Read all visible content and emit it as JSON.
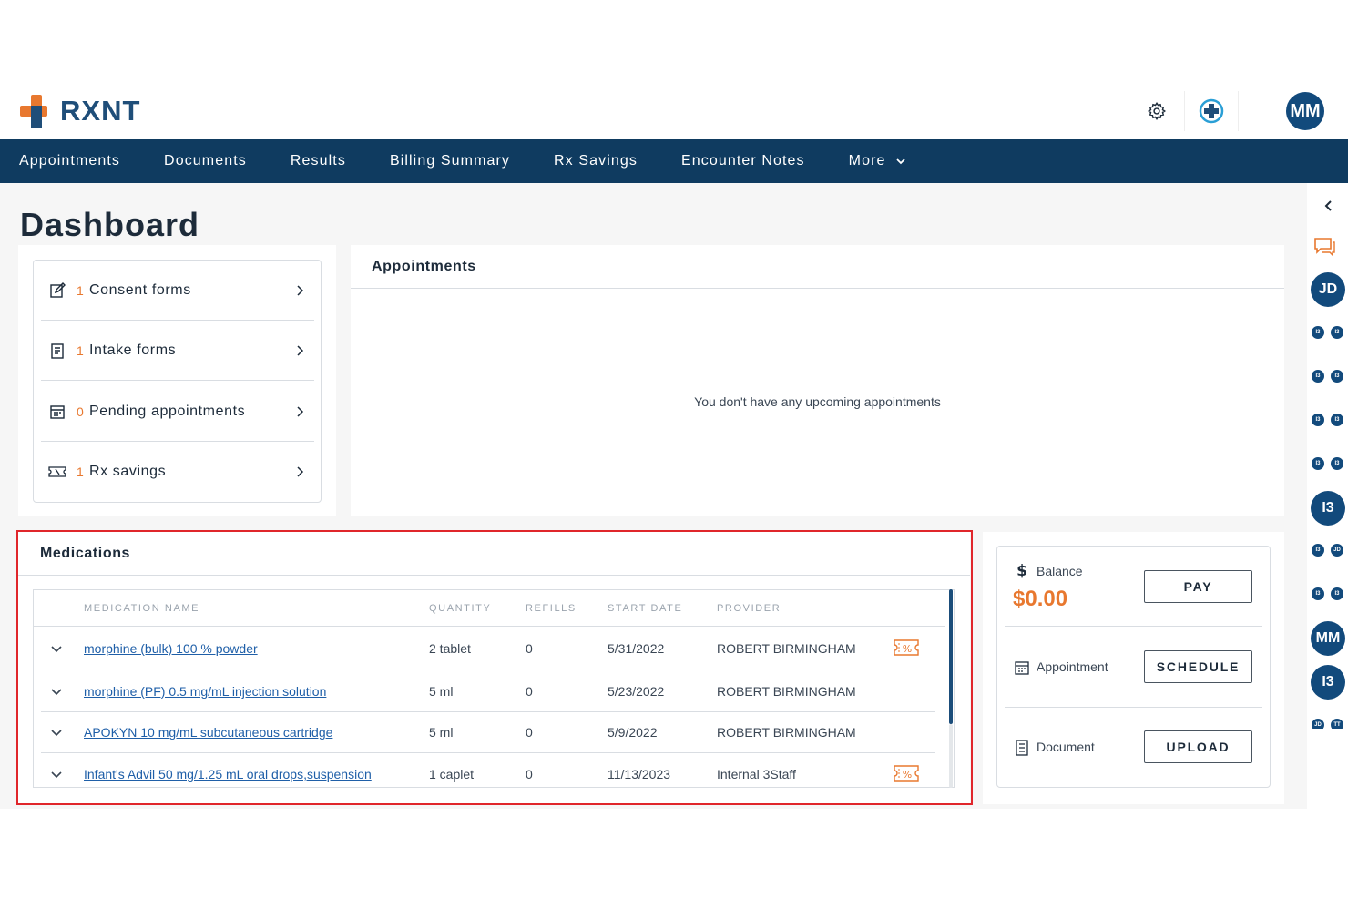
{
  "header": {
    "brand": "RXNT",
    "user_initials": "MM",
    "colors": {
      "brand_blue": "#1f4e79",
      "brand_orange": "#e8782f",
      "nav_bg": "#0f3b60"
    }
  },
  "nav": {
    "items": [
      "Appointments",
      "Documents",
      "Results",
      "Billing Summary",
      "Rx Savings",
      "Encounter Notes"
    ],
    "more_label": "More"
  },
  "page_title": "Dashboard",
  "quick_links": [
    {
      "count": "1",
      "label": "Consent forms",
      "icon": "edit-form-icon"
    },
    {
      "count": "1",
      "label": "Intake forms",
      "icon": "clipboard-icon"
    },
    {
      "count": "0",
      "label": "Pending appointments",
      "icon": "calendar-icon"
    },
    {
      "count": "1",
      "label": "Rx savings",
      "icon": "coupon-icon"
    }
  ],
  "appointments": {
    "title": "Appointments",
    "empty_message": "You don't have any upcoming appointments"
  },
  "medications": {
    "title": "Medications",
    "columns": [
      "MEDICATION NAME",
      "QUANTITY",
      "REFILLS",
      "START DATE",
      "PROVIDER"
    ],
    "rows": [
      {
        "name": "morphine (bulk) 100 % powder",
        "quantity": "2 tablet",
        "refills": "0",
        "start_date": "5/31/2022",
        "provider": "ROBERT BIRMINGHAM",
        "rx_savings": true
      },
      {
        "name": "morphine (PF) 0.5 mg/mL injection solution",
        "quantity": "5 ml",
        "refills": "0",
        "start_date": "5/23/2022",
        "provider": "ROBERT BIRMINGHAM",
        "rx_savings": false
      },
      {
        "name": "APOKYN 10 mg/mL subcutaneous cartridge",
        "quantity": "5 ml",
        "refills": "0",
        "start_date": "5/9/2022",
        "provider": "ROBERT BIRMINGHAM",
        "rx_savings": false
      },
      {
        "name": "Infant's Advil 50 mg/1.25 mL oral drops,suspension",
        "quantity": "1 caplet",
        "refills": "0",
        "start_date": "11/13/2023",
        "provider": "Internal 3Staff",
        "rx_savings": true
      }
    ]
  },
  "billing": {
    "balance_label": "Balance",
    "balance_amount": "$0.00",
    "pay_label": "PAY",
    "appointment_label": "Appointment",
    "schedule_label": "SCHEDULE",
    "document_label": "Document",
    "upload_label": "UPLOAD"
  },
  "rail": {
    "avatars": [
      "JD",
      "I3",
      "MM",
      "I3"
    ],
    "small_pairs": [
      [
        "I3",
        "I3"
      ],
      [
        "I3",
        "I3"
      ],
      [
        "I3",
        "I3"
      ],
      [
        "I3",
        "I3"
      ],
      [
        "I3",
        "JD"
      ],
      [
        "I3",
        "I3"
      ],
      [
        "JD",
        "TT"
      ]
    ]
  }
}
